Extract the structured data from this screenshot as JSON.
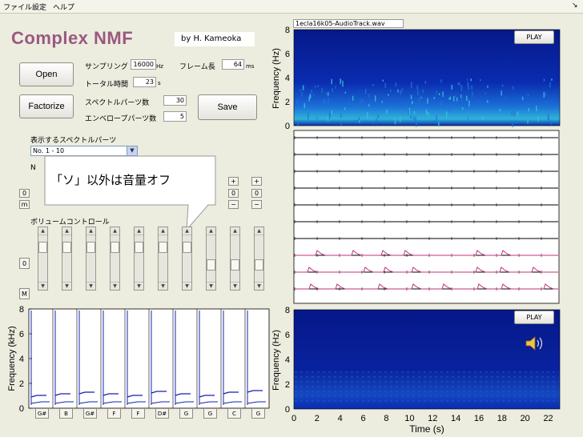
{
  "menu": {
    "file": "ファイル",
    "settings": "設定",
    "help": "ヘルプ",
    "corner": "↘"
  },
  "app": {
    "title": "Complex NMF",
    "author": "by H. Kameoka"
  },
  "buttons": {
    "open": "Open",
    "factorize": "Factorize",
    "save": "Save",
    "play_top": "PLAY",
    "play_bottom": "PLAY"
  },
  "params": {
    "sampling_label": "サンプリング",
    "sampling_value": "16000",
    "sampling_unit": "Hz",
    "frame_label": "フレーム長",
    "frame_value": "64",
    "frame_unit": "ms",
    "total_label": "トータル時間",
    "total_value": "23",
    "total_unit": "s",
    "spectral_label": "スペクトルパーツ数",
    "spectral_value": "30",
    "envelope_label": "エンベロープパーツ数",
    "envelope_value": "5"
  },
  "display": {
    "label": "表示するスペクトルパーツ",
    "select": "No. 1 - 10",
    "label2_prefix": "N"
  },
  "volume": {
    "label": "ボリュームコントロール"
  },
  "callout": {
    "text": "「ソ」以外は音量オフ"
  },
  "row_buttons": {
    "zero": "0",
    "mute": "m",
    "plus": "+",
    "minus": "−"
  },
  "left_buttons": {
    "zero2": "0",
    "m2": "M"
  },
  "channels": {
    "plus_btn_zero_a": "0",
    "plus_btn_zero_b": "0"
  },
  "audio": {
    "filename": "1ecla16k05-AudioTrack.wav"
  },
  "axes": {
    "freq_label": "Frequency (Hz)",
    "freq_label_khz": "Frequency (kHz)",
    "time_label": "Time (s)",
    "y_ticks_top": [
      "8",
      "6",
      "4",
      "2",
      "0"
    ],
    "y_ticks_bottom": [
      "8",
      "6",
      "4",
      "2",
      "0"
    ],
    "y_ticks_left": [
      "8",
      "6",
      "4",
      "2",
      "0"
    ],
    "x_ticks": [
      "0",
      "2",
      "4",
      "6",
      "8",
      "10",
      "12",
      "14",
      "16",
      "18",
      "20",
      "22"
    ]
  },
  "notes": [
    "G#",
    "B",
    "G#",
    "F",
    "F",
    "D#",
    "G",
    "G",
    "C",
    "G"
  ],
  "colors": {
    "accent_title": "#9a5880",
    "spectro_bg": "#0a1a8c",
    "activation_line": "#c0307a",
    "part_line": "#1020b0"
  }
}
